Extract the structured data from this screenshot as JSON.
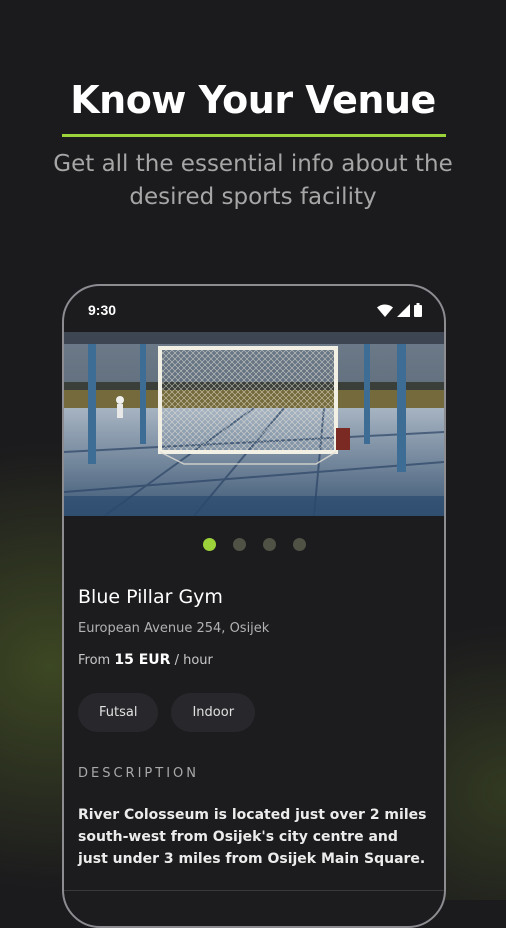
{
  "promo": {
    "headline": "Know Your Venue",
    "subtitle": "Get all the essential info about the desired sports facility",
    "accent_color": "#9cd23a"
  },
  "status_bar": {
    "time": "9:30",
    "icons": [
      "wifi-icon",
      "signal-icon",
      "battery-icon"
    ]
  },
  "gallery": {
    "image": "futsal-goal-photo",
    "pages": 4,
    "active_page": 1
  },
  "venue": {
    "name": "Blue Pillar Gym",
    "address": "European Avenue 254, Osijek",
    "price": {
      "prefix": "From",
      "amount": "15 EUR",
      "suffix": "/ hour"
    },
    "tags": [
      "Futsal",
      "Indoor"
    ],
    "description_heading": "DESCRIPTION",
    "description": "River Colosseum is located just over 2 miles south-west from Osijek's city centre and just under 3 miles from Osijek Main Square."
  }
}
